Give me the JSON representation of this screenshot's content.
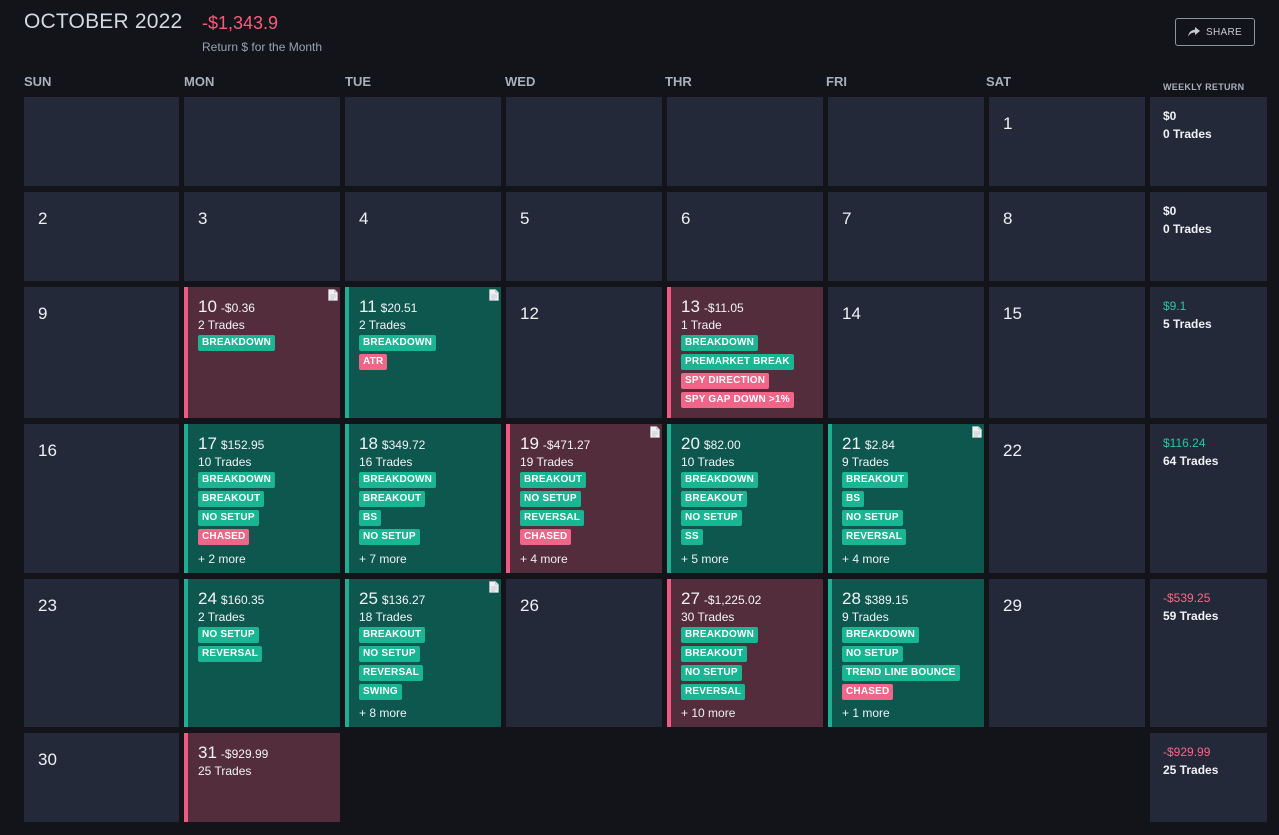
{
  "header": {
    "month": "OCTOBER 2022",
    "total": "-$1,343.9",
    "caption": "Return $ for the Month",
    "share_label": "SHARE"
  },
  "days": [
    "SUN",
    "MON",
    "TUE",
    "WED",
    "THR",
    "FRI",
    "SAT"
  ],
  "weekly_header": "WEEKLY RETURN",
  "weeks": [
    {
      "weekly": {
        "amount": "$0",
        "trades": "0 Trades",
        "tone": "neutral"
      },
      "cells": [
        {
          "type": "empty_box"
        },
        {
          "type": "empty_box"
        },
        {
          "type": "empty_box"
        },
        {
          "type": "empty_box"
        },
        {
          "type": "empty_box"
        },
        {
          "type": "empty_box"
        },
        {
          "type": "day",
          "num": "1"
        }
      ]
    },
    {
      "weekly": {
        "amount": "$0",
        "trades": "0 Trades",
        "tone": "neutral"
      },
      "cells": [
        {
          "type": "day",
          "num": "2"
        },
        {
          "type": "day",
          "num": "3"
        },
        {
          "type": "day",
          "num": "4"
        },
        {
          "type": "day",
          "num": "5"
        },
        {
          "type": "day",
          "num": "6"
        },
        {
          "type": "day",
          "num": "7"
        },
        {
          "type": "day",
          "num": "8"
        }
      ]
    },
    {
      "weekly": {
        "amount": "$9.1",
        "trades": "5 Trades",
        "tone": "pos"
      },
      "cells": [
        {
          "type": "day",
          "num": "9"
        },
        {
          "type": "trade",
          "result": "loss",
          "num": "10",
          "amount": "-$0.36",
          "count": "2 Trades",
          "note": true,
          "tags": [
            {
              "label": "BREAKDOWN",
              "color": "g"
            }
          ]
        },
        {
          "type": "trade",
          "result": "win",
          "num": "11",
          "amount": "$20.51",
          "count": "2 Trades",
          "note": true,
          "tags": [
            {
              "label": "BREAKDOWN",
              "color": "g"
            },
            {
              "label": "ATR",
              "color": "r"
            }
          ]
        },
        {
          "type": "day",
          "num": "12"
        },
        {
          "type": "trade",
          "result": "loss",
          "num": "13",
          "amount": "-$11.05",
          "count": "1 Trade",
          "note": false,
          "tags": [
            {
              "label": "BREAKDOWN",
              "color": "g"
            },
            {
              "label": "PREMARKET BREAK",
              "color": "g"
            },
            {
              "label": "SPY DIRECTION",
              "color": "r"
            },
            {
              "label": "SPY GAP DOWN >1%",
              "color": "r"
            }
          ]
        },
        {
          "type": "day",
          "num": "14"
        },
        {
          "type": "day",
          "num": "15"
        }
      ]
    },
    {
      "weekly": {
        "amount": "$116.24",
        "trades": "64 Trades",
        "tone": "pos"
      },
      "cells": [
        {
          "type": "day",
          "num": "16"
        },
        {
          "type": "trade",
          "result": "win",
          "num": "17",
          "amount": "$152.95",
          "count": "10 Trades",
          "note": false,
          "tags": [
            {
              "label": "BREAKDOWN",
              "color": "g"
            },
            {
              "label": "BREAKOUT",
              "color": "g"
            },
            {
              "label": "NO SETUP",
              "color": "g"
            },
            {
              "label": "CHASED",
              "color": "r"
            }
          ],
          "more": "+ 2 more"
        },
        {
          "type": "trade",
          "result": "win",
          "num": "18",
          "amount": "$349.72",
          "count": "16 Trades",
          "note": false,
          "tags": [
            {
              "label": "BREAKDOWN",
              "color": "g"
            },
            {
              "label": "BREAKOUT",
              "color": "g"
            },
            {
              "label": "BS",
              "color": "g"
            },
            {
              "label": "NO SETUP",
              "color": "g"
            }
          ],
          "more": "+ 7 more"
        },
        {
          "type": "trade",
          "result": "loss",
          "num": "19",
          "amount": "-$471.27",
          "count": "19 Trades",
          "note": true,
          "tags": [
            {
              "label": "BREAKOUT",
              "color": "g"
            },
            {
              "label": "NO SETUP",
              "color": "g"
            },
            {
              "label": "REVERSAL",
              "color": "g"
            },
            {
              "label": "CHASED",
              "color": "r"
            }
          ],
          "more": "+ 4 more"
        },
        {
          "type": "trade",
          "result": "win",
          "num": "20",
          "amount": "$82.00",
          "count": "10 Trades",
          "note": false,
          "tags": [
            {
              "label": "BREAKDOWN",
              "color": "g"
            },
            {
              "label": "BREAKOUT",
              "color": "g"
            },
            {
              "label": "NO SETUP",
              "color": "g"
            },
            {
              "label": "SS",
              "color": "g"
            }
          ],
          "more": "+ 5 more"
        },
        {
          "type": "trade",
          "result": "win",
          "num": "21",
          "amount": "$2.84",
          "count": "9 Trades",
          "note": true,
          "tags": [
            {
              "label": "BREAKOUT",
              "color": "g"
            },
            {
              "label": "BS",
              "color": "g"
            },
            {
              "label": "NO SETUP",
              "color": "g"
            },
            {
              "label": "REVERSAL",
              "color": "g"
            }
          ],
          "more": "+ 4 more"
        },
        {
          "type": "day",
          "num": "22"
        }
      ]
    },
    {
      "weekly": {
        "amount": "-$539.25",
        "trades": "59 Trades",
        "tone": "neg"
      },
      "cells": [
        {
          "type": "day",
          "num": "23"
        },
        {
          "type": "trade",
          "result": "win",
          "num": "24",
          "amount": "$160.35",
          "count": "2 Trades",
          "note": false,
          "tags": [
            {
              "label": "NO SETUP",
              "color": "g"
            },
            {
              "label": "REVERSAL",
              "color": "g"
            }
          ]
        },
        {
          "type": "trade",
          "result": "win",
          "num": "25",
          "amount": "$136.27",
          "count": "18 Trades",
          "note": true,
          "tags": [
            {
              "label": "BREAKOUT",
              "color": "g"
            },
            {
              "label": "NO SETUP",
              "color": "g"
            },
            {
              "label": "REVERSAL",
              "color": "g"
            },
            {
              "label": "SWING",
              "color": "g"
            }
          ],
          "more": "+ 8 more"
        },
        {
          "type": "day",
          "num": "26"
        },
        {
          "type": "trade",
          "result": "loss",
          "num": "27",
          "amount": "-$1,225.02",
          "count": "30 Trades",
          "note": false,
          "tags": [
            {
              "label": "BREAKDOWN",
              "color": "g"
            },
            {
              "label": "BREAKOUT",
              "color": "g"
            },
            {
              "label": "NO SETUP",
              "color": "g"
            },
            {
              "label": "REVERSAL",
              "color": "g"
            }
          ],
          "more": "+ 10 more"
        },
        {
          "type": "trade",
          "result": "win",
          "num": "28",
          "amount": "$389.15",
          "count": "9 Trades",
          "note": false,
          "tags": [
            {
              "label": "BREAKDOWN",
              "color": "g"
            },
            {
              "label": "NO SETUP",
              "color": "g"
            },
            {
              "label": "TREND LINE BOUNCE",
              "color": "g"
            },
            {
              "label": "CHASED",
              "color": "r"
            }
          ],
          "more": "+ 1 more"
        },
        {
          "type": "day",
          "num": "29"
        }
      ]
    },
    {
      "weekly": {
        "amount": "-$929.99",
        "trades": "25 Trades",
        "tone": "neg"
      },
      "cells": [
        {
          "type": "day",
          "num": "30"
        },
        {
          "type": "trade",
          "result": "loss",
          "num": "31",
          "amount": "-$929.99",
          "count": "25 Trades",
          "note": false,
          "tags": []
        },
        {
          "type": "empty"
        },
        {
          "type": "empty"
        },
        {
          "type": "empty"
        },
        {
          "type": "empty"
        },
        {
          "type": "empty"
        }
      ]
    }
  ]
}
